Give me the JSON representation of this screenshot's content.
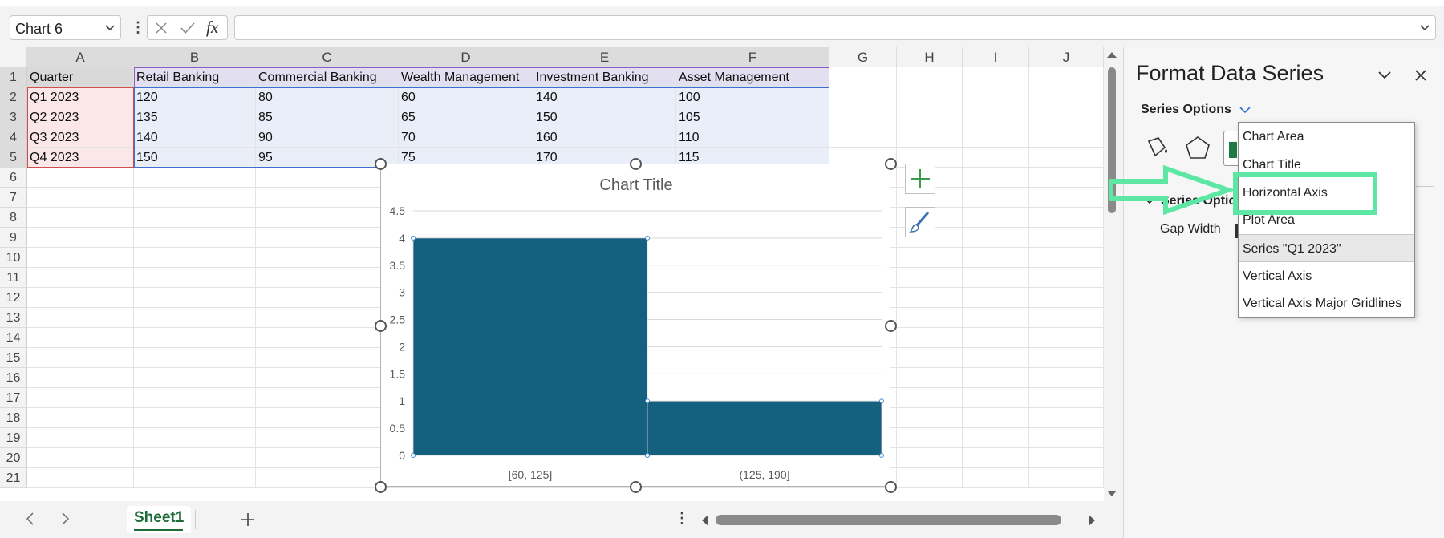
{
  "formula_bar": {
    "name_box": "Chart 6",
    "fx": "fx"
  },
  "columns": [
    "A",
    "B",
    "C",
    "D",
    "E",
    "F",
    "G",
    "H",
    "I",
    "J"
  ],
  "rows": [
    "1",
    "2",
    "3",
    "4",
    "5",
    "6",
    "7",
    "8",
    "9",
    "10",
    "11",
    "12",
    "13",
    "14",
    "15",
    "16",
    "17",
    "18",
    "19",
    "20",
    "21"
  ],
  "table": {
    "headers": [
      "Quarter",
      "Retail Banking",
      "Commercial Banking",
      "Wealth Management",
      "Investment Banking",
      "Asset Management"
    ],
    "rows": [
      [
        "Q1 2023",
        "120",
        "80",
        "60",
        "140",
        "100"
      ],
      [
        "Q2 2023",
        "135",
        "85",
        "65",
        "150",
        "105"
      ],
      [
        "Q3 2023",
        "140",
        "90",
        "70",
        "160",
        "110"
      ],
      [
        "Q4 2023",
        "150",
        "95",
        "75",
        "170",
        "115"
      ]
    ]
  },
  "sheet_tabs": {
    "active": "Sheet1"
  },
  "chart_data": {
    "type": "bar",
    "title": "Chart Title",
    "categories": [
      "[60, 125]",
      "(125, 190]"
    ],
    "values": [
      4,
      1
    ],
    "ylim": [
      0,
      4.5
    ],
    "yticks": [
      "0",
      "0.5",
      "1",
      "1.5",
      "2",
      "2.5",
      "3",
      "3.5",
      "4",
      "4.5"
    ],
    "grid": true,
    "bar_color": "#16607f"
  },
  "panel": {
    "title": "Format Data Series",
    "series_options_label": "Series Options",
    "section_label": "Series Optio",
    "gap_width_label": "Gap Width",
    "dropdown_items": [
      "Chart Area",
      "Chart Title",
      "Horizontal Axis",
      "Plot Area",
      "Series \"Q1 2023\"",
      "Vertical Axis",
      "Vertical Axis Major Gridlines"
    ],
    "selected_item": "Series \"Q1 2023\""
  },
  "colors": {
    "accent_green": "#5de6a4",
    "excel_green": "#1e6b3a"
  }
}
